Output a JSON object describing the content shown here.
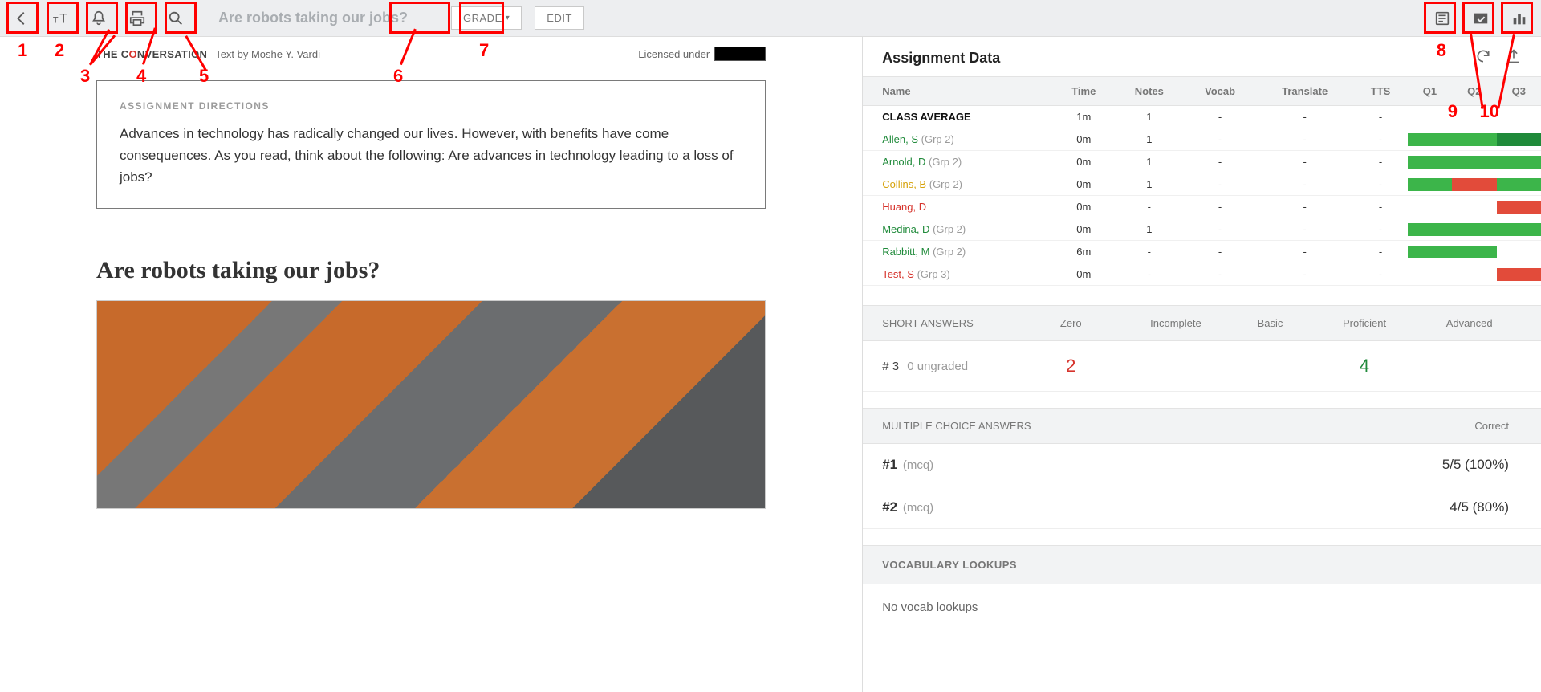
{
  "toolbar": {
    "title": "Are robots taking our jobs?",
    "grade_label": "GRADE",
    "edit_label": "EDIT"
  },
  "annotations": [
    "1",
    "2",
    "3",
    "4",
    "5",
    "6",
    "7",
    "8",
    "9",
    "10"
  ],
  "article": {
    "source_logo_pre": "THE C",
    "source_logo_o": "O",
    "source_logo_post": "NVERSATION",
    "byline": "Text by Moshe Y. Vardi",
    "licensed": "Licensed under",
    "directions_heading": "ASSIGNMENT DIRECTIONS",
    "directions_text": "Advances in technology has radically changed our lives. However, with benefits have come consequences. As you read, think about the following: Are advances in technology leading to a loss of jobs?",
    "title": "Are robots taking our jobs?"
  },
  "panel": {
    "heading": "Assignment Data",
    "columns": [
      "Name",
      "Time",
      "Notes",
      "Vocab",
      "Translate",
      "TTS",
      "Q1",
      "Q2",
      "Q3"
    ],
    "rows": [
      {
        "name": "CLASS AVERAGE",
        "grp": "",
        "style": "name-bold",
        "time": "1m",
        "notes": "1",
        "vocab": "-",
        "translate": "-",
        "tts": "-",
        "q": [
          "e",
          "e",
          "e"
        ]
      },
      {
        "name": "Allen, S",
        "grp": "(Grp 2)",
        "style": "name-green",
        "time": "0m",
        "notes": "1",
        "vocab": "-",
        "translate": "-",
        "tts": "-",
        "q": [
          "g",
          "g",
          "dg"
        ]
      },
      {
        "name": "Arnold, D",
        "grp": "(Grp 2)",
        "style": "name-green",
        "time": "0m",
        "notes": "1",
        "vocab": "-",
        "translate": "-",
        "tts": "-",
        "q": [
          "g",
          "g",
          "g"
        ]
      },
      {
        "name": "Collins, B",
        "grp": "(Grp 2)",
        "style": "name-yellow",
        "time": "0m",
        "notes": "1",
        "vocab": "-",
        "translate": "-",
        "tts": "-",
        "q": [
          "g",
          "r",
          "g"
        ]
      },
      {
        "name": "Huang, D",
        "grp": "",
        "style": "name-red",
        "time": "0m",
        "notes": "-",
        "vocab": "-",
        "translate": "-",
        "tts": "-",
        "q": [
          "e",
          "e",
          "r"
        ]
      },
      {
        "name": "Medina, D",
        "grp": "(Grp 2)",
        "style": "name-green",
        "time": "0m",
        "notes": "1",
        "vocab": "-",
        "translate": "-",
        "tts": "-",
        "q": [
          "g",
          "g",
          "g"
        ]
      },
      {
        "name": "Rabbitt, M",
        "grp": "(Grp 2)",
        "style": "name-green",
        "time": "6m",
        "notes": "-",
        "vocab": "-",
        "translate": "-",
        "tts": "-",
        "q": [
          "g",
          "g",
          "e"
        ]
      },
      {
        "name": "Test, S",
        "grp": "(Grp 3)",
        "style": "name-red",
        "time": "0m",
        "notes": "-",
        "vocab": "-",
        "translate": "-",
        "tts": "-",
        "q": [
          "e",
          "e",
          "r"
        ]
      }
    ],
    "short_answers": {
      "heading": "SHORT ANSWERS",
      "cols": [
        "Zero",
        "Incomplete",
        "Basic",
        "Proficient",
        "Advanced"
      ],
      "row_label": "# 3",
      "row_ungraded": "0 ungraded",
      "zero": "2",
      "incomplete": "",
      "basic": "",
      "proficient": "4",
      "advanced": ""
    },
    "mc": {
      "heading": "MULTIPLE CHOICE ANSWERS",
      "correct_label": "Correct",
      "rows": [
        {
          "idx": "#1",
          "type": "(mcq)",
          "correct": "5/5 (100%)"
        },
        {
          "idx": "#2",
          "type": "(mcq)",
          "correct": "4/5 (80%)"
        }
      ]
    },
    "vocab": {
      "heading": "VOCABULARY LOOKUPS",
      "body": "No vocab lookups"
    }
  }
}
